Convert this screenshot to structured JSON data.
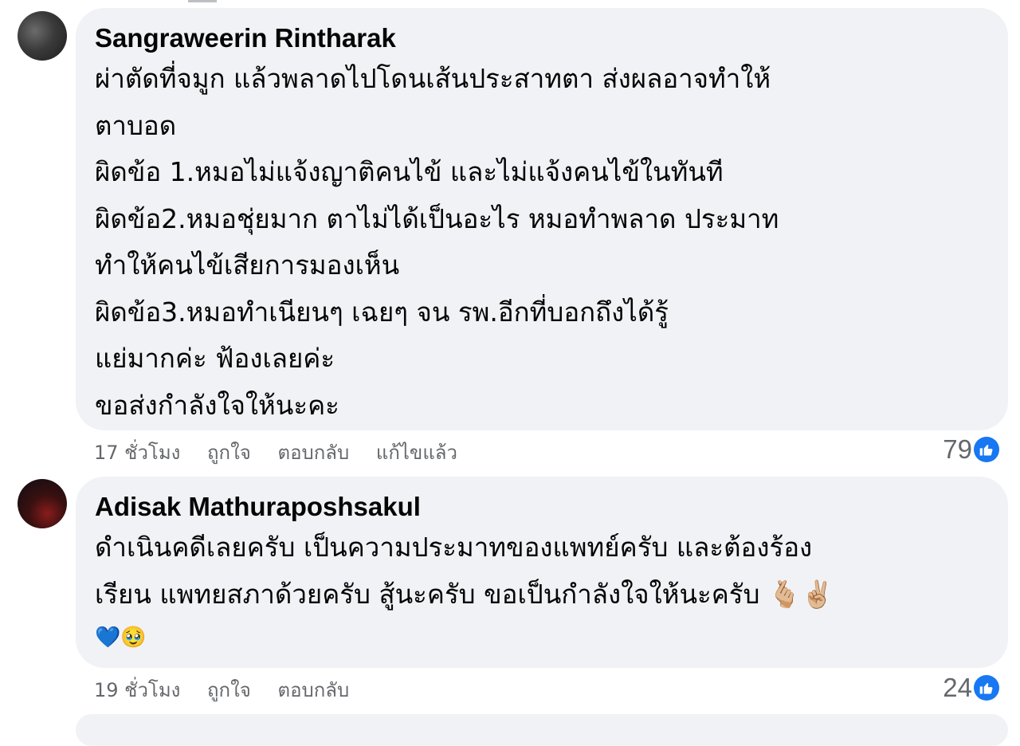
{
  "comments": [
    {
      "author": "Sangraweerin Rintharak",
      "lines": [
        "ผ่าตัดที่จมูก แล้วพลาดไปโดนเส้นประสาทตา ส่งผลอาจทำให้",
        "ตาบอด",
        "ผิดข้อ 1.หมอไม่แจ้งญาติคนไข้ และไม่แจ้งคนไข้ในทันที",
        "ผิดข้อ2.หมอชุ่ยมาก ตาไม่ได้เป็นอะไร หมอทำพลาด ประมาท",
        "ทำให้คนไข้เสียการมองเห็น",
        "ผิดข้อ3.หมอทำเนียนๆ เฉยๆ จน รพ.อีกที่บอกถึงได้รู้",
        "แย่มากค่ะ ฟ้องเลยค่ะ",
        "ขอส่งกำลังใจให้นะคะ"
      ],
      "time": "17 ชั่วโมง",
      "like_label": "ถูกใจ",
      "reply_label": "ตอบกลับ",
      "edited_label": "แก้ไขแล้ว",
      "reaction_count": "79",
      "reaction_icon": "thumbs-up-icon"
    },
    {
      "author": "Adisak Mathuraposhsakul",
      "lines": [
        "ดำเนินคดีเลยครับ เป็นความประมาทของแพทย์ครับ และต้องร้อง",
        "เรียน แพทยสภาด้วยครับ สู้นะครับ ขอเป็นกำลังใจให้นะครับ 🫰🏼✌🏼",
        "💙🥹"
      ],
      "time": "19 ชั่วโมง",
      "like_label": "ถูกใจ",
      "reply_label": "ตอบกลับ",
      "reaction_count": "24",
      "reaction_icon": "thumbs-up-icon"
    }
  ],
  "colors": {
    "bubble": "#f0f2f5",
    "text": "#050505",
    "meta": "#65676b",
    "like_blue": "#1877f2"
  }
}
